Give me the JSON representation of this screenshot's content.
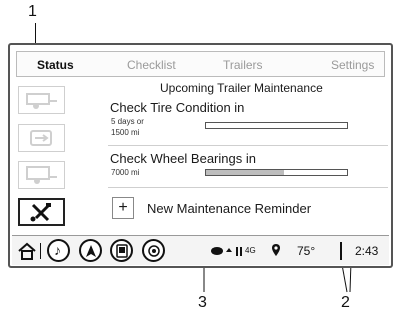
{
  "callouts": {
    "c1": "1",
    "c2": "2",
    "c3": "3"
  },
  "tabs": [
    {
      "label": "Status",
      "active": true
    },
    {
      "label": "Checklist",
      "active": false
    },
    {
      "label": "Trailers",
      "active": false
    },
    {
      "label": "Settings",
      "active": false
    }
  ],
  "panel": {
    "title": "Upcoming Trailer Maintenance",
    "items": [
      {
        "label": "Check Tire Condition in",
        "sub1": "5 days or",
        "sub2": "1500 mi",
        "progress": 0.0
      },
      {
        "label": "Check Wheel Bearings in",
        "sub1": "7000 mi",
        "progress": 0.55
      }
    ],
    "add_symbol": "+",
    "add_label": "New Maintenance Reminder"
  },
  "status_bar": {
    "temperature": "75°",
    "time": "2:43",
    "signal_label": "4G"
  },
  "colors": {
    "frame": "#555555",
    "bar_fill": "#bdbdbd",
    "text": "#1a1a1a",
    "muted": "#9a9a9a"
  },
  "icons": [
    "trailer-icon",
    "trailer-connection-icon",
    "trailer-side-icon",
    "tools-icon",
    "home-icon",
    "audio-icon",
    "navigation-icon",
    "phone-icon",
    "apps-icon",
    "location-pin-icon"
  ]
}
